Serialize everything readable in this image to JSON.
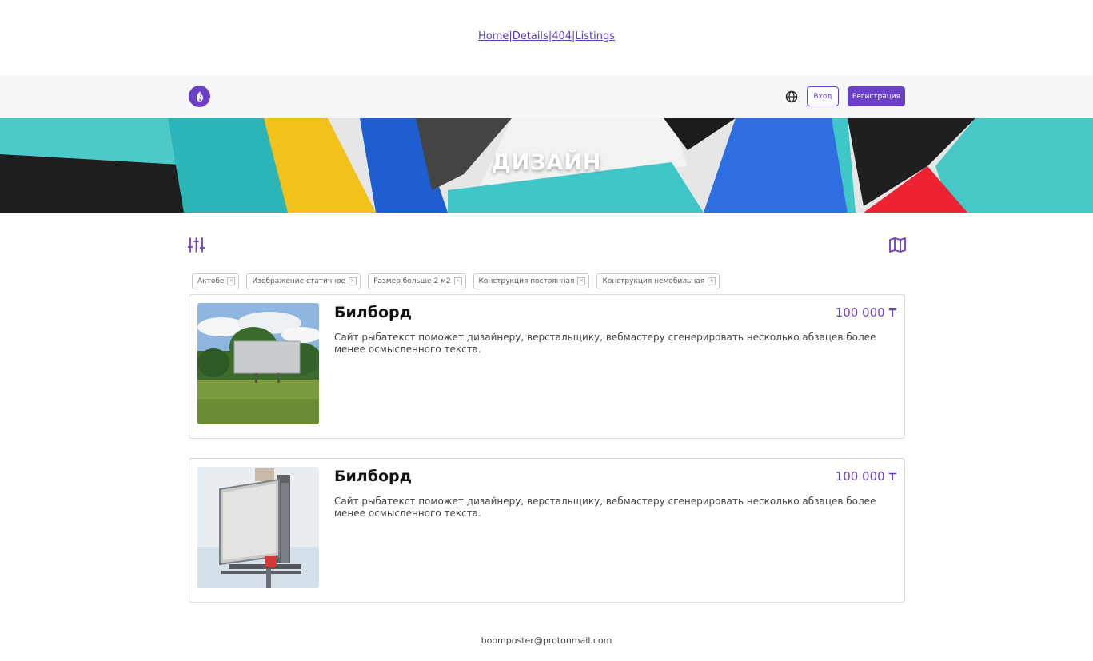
{
  "topnav": {
    "links": [
      "Home",
      "Details",
      "404",
      "Listings"
    ],
    "separator": "|"
  },
  "header": {
    "logo_icon": "flame-logo-icon",
    "language_icon": "globe-icon",
    "login_label": "Вход",
    "register_label": "Регистрация",
    "brand_color": "#6c3fc7"
  },
  "hero": {
    "title": "ДИЗАЙН"
  },
  "toolbar": {
    "filter_icon": "sliders-icon",
    "map_icon": "map-icon"
  },
  "filters": [
    {
      "label": "Актобе"
    },
    {
      "label": "Изображение статичное"
    },
    {
      "label": "Размер больше 2 м2"
    },
    {
      "label": "Конструкция постоянная"
    },
    {
      "label": "Конструкция немобильная"
    }
  ],
  "listings": [
    {
      "title": "Билборд",
      "price": "100 000 ₸",
      "description": "Сайт рыбатекст поможет дизайнеру, верстальщику, вебмастеру сгенерировать несколько абзацев более менее осмысленного текста."
    },
    {
      "title": "Билборд",
      "price": "100 000 ₸",
      "description": "Сайт рыбатекст поможет дизайнеру, верстальщику, вебмастеру сгенерировать несколько абзацев более менее осмысленного текста."
    }
  ],
  "footer": {
    "email": "boomposter@protonmail.com"
  }
}
